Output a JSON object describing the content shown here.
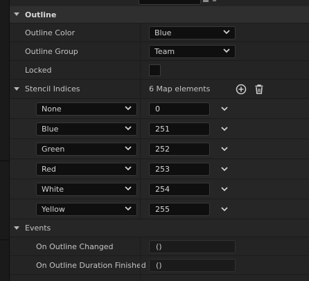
{
  "outline_section": {
    "title": "Outline",
    "outline_color": {
      "label": "Outline Color",
      "value": "Blue"
    },
    "outline_group": {
      "label": "Outline Group",
      "value": "Team"
    },
    "locked": {
      "label": "Locked",
      "checked": false
    }
  },
  "stencil_indices": {
    "label": "Stencil Indices",
    "summary": "6 Map elements",
    "entries": [
      {
        "key": "None",
        "value": "0"
      },
      {
        "key": "Blue",
        "value": "251"
      },
      {
        "key": "Green",
        "value": "252"
      },
      {
        "key": "Red",
        "value": "253"
      },
      {
        "key": "White",
        "value": "254"
      },
      {
        "key": "Yellow",
        "value": "255"
      }
    ]
  },
  "events_section": {
    "title": "Events",
    "on_outline_changed": {
      "label": "On Outline Changed",
      "value": "()"
    },
    "on_outline_duration_finished": {
      "label": "On Outline Duration Finished",
      "value": "()"
    }
  },
  "icons": {
    "add": "plus-circle-icon",
    "remove": "trash-icon",
    "expand": "chevron-down-icon",
    "category": "triangle-down-icon"
  }
}
